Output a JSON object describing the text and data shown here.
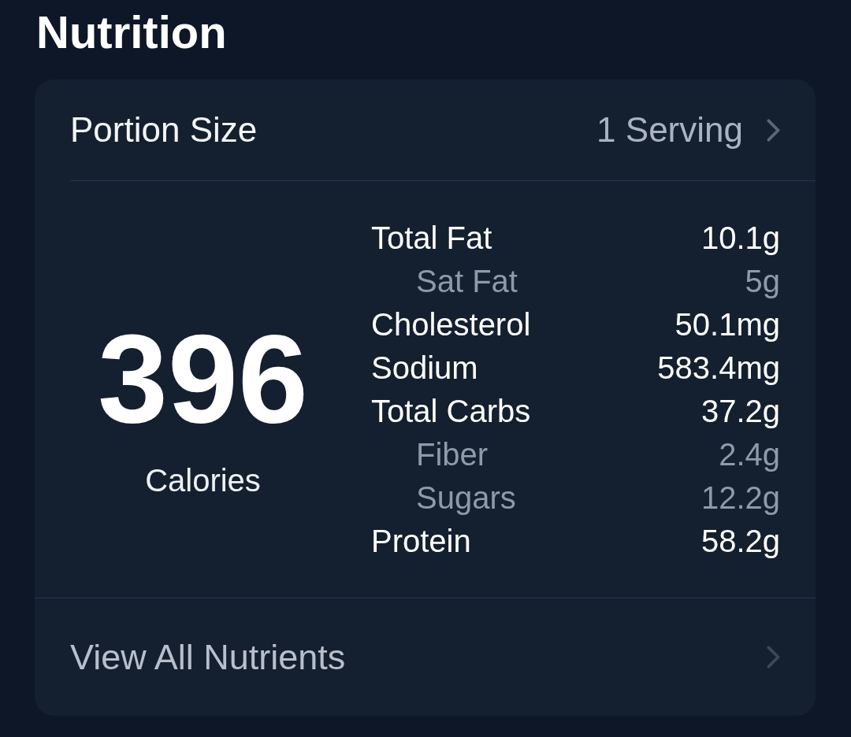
{
  "title": "Nutrition",
  "portion": {
    "label": "Portion Size",
    "value": "1 Serving"
  },
  "calories": {
    "value": "396",
    "label": "Calories"
  },
  "nutrients": [
    {
      "name": "Total Fat",
      "amount": "10.1g",
      "kind": "main"
    },
    {
      "name": "Sat Fat",
      "amount": "5g",
      "kind": "sub"
    },
    {
      "name": "Cholesterol",
      "amount": "50.1mg",
      "kind": "main"
    },
    {
      "name": "Sodium",
      "amount": "583.4mg",
      "kind": "main"
    },
    {
      "name": "Total Carbs",
      "amount": "37.2g",
      "kind": "main"
    },
    {
      "name": "Fiber",
      "amount": "2.4g",
      "kind": "sub"
    },
    {
      "name": "Sugars",
      "amount": "12.2g",
      "kind": "sub"
    },
    {
      "name": "Protein",
      "amount": "58.2g",
      "kind": "main"
    }
  ],
  "footer": {
    "label": "View All Nutrients"
  }
}
